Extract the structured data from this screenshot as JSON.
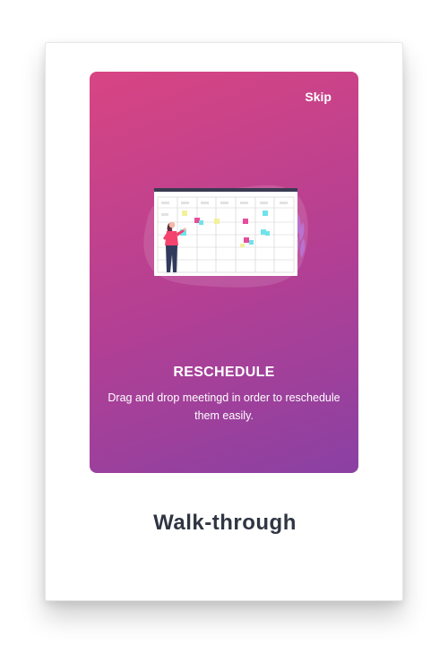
{
  "walkthrough": {
    "skip_label": "Skip",
    "slide_title": "RESCHEDULE",
    "slide_description": "Drag and drop meetingd in order to reschedule them easily."
  },
  "caption": "Walk-through",
  "colors": {
    "gradient_start": "#d84583",
    "gradient_end": "#8a41a3",
    "caption_text": "#2f3542",
    "sticky_pink": "#e84d9c",
    "sticky_yellow": "#f4f19a",
    "sticky_cyan": "#6fe3ea"
  },
  "icons": [
    "calendar-board-illustration",
    "person-illustration",
    "plant-illustration"
  ]
}
